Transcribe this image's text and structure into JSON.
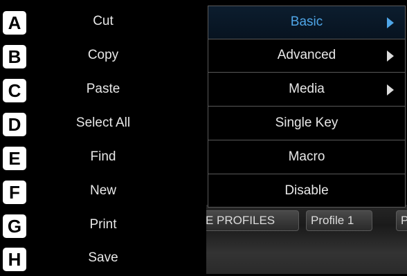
{
  "left_menu": {
    "items": [
      {
        "key": "A",
        "label": "Cut"
      },
      {
        "key": "B",
        "label": "Copy"
      },
      {
        "key": "C",
        "label": "Paste"
      },
      {
        "key": "D",
        "label": "Select All"
      },
      {
        "key": "E",
        "label": "Find"
      },
      {
        "key": "F",
        "label": "New"
      },
      {
        "key": "G",
        "label": "Print"
      },
      {
        "key": "H",
        "label": "Save"
      }
    ]
  },
  "submenu": {
    "items": [
      {
        "label": "Basic",
        "has_submenu": true,
        "selected": true
      },
      {
        "label": "Advanced",
        "has_submenu": true
      },
      {
        "label": "Media",
        "has_submenu": true
      },
      {
        "label": "Single Key"
      },
      {
        "label": "Macro"
      },
      {
        "label": "Disable"
      }
    ]
  },
  "background_tabs": {
    "profiles_label": "E PROFILES",
    "profile1_label": "Profile 1",
    "next_label": "P"
  },
  "colors": {
    "selected_text": "#4fa6e8",
    "menu_text": "#e8e8e8",
    "key_badge": "#ffffff"
  }
}
